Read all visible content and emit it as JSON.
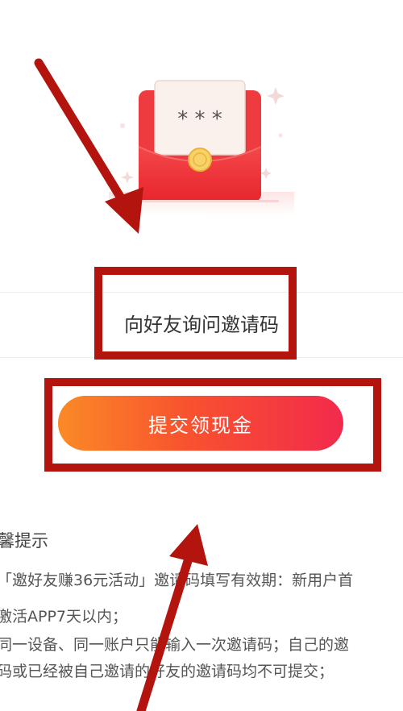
{
  "envelope": {
    "card_text": "* * *"
  },
  "invite": {
    "placeholder": "向好友询问邀请码"
  },
  "submit": {
    "label": "提交领现金"
  },
  "tips": {
    "title": "馨提示",
    "lines": [
      "「邀好友赚36元活动」邀请码填写有效期：新用户首",
      "激活APP7天以内；",
      "同一设备、同一账户只能输入一次邀请码；自己的邀",
      "码或已经被自己邀请的好友的邀请码均不可提交；"
    ]
  },
  "colors": {
    "annotation_red": "#b3140e",
    "button_gradient_start": "#fb8a26",
    "button_gradient_end": "#f22a4c"
  }
}
